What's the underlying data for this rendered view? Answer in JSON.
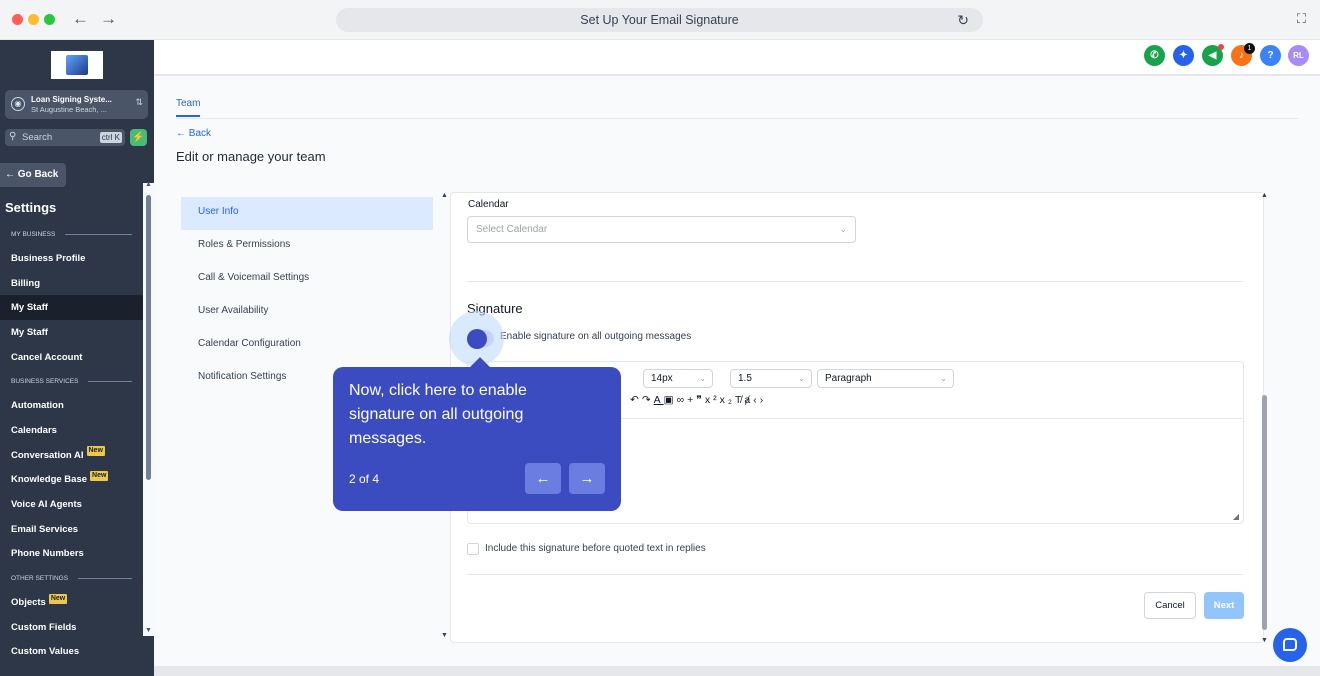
{
  "browser": {
    "url_title": "Set Up Your Email Signature"
  },
  "sidebar": {
    "account_name": "Loan Signing Syste...",
    "account_location": "St Augustine Beach, ...",
    "search_placeholder": "Search",
    "search_shortcut": "ctrl K",
    "go_back": "← Go Back",
    "settings_title": "Settings",
    "menu": [
      {
        "type": "section",
        "label": "MY BUSINESS"
      },
      {
        "type": "item",
        "label": "Business Profile"
      },
      {
        "type": "item",
        "label": "Billing"
      },
      {
        "type": "item",
        "label": "My Staff",
        "active": true
      },
      {
        "type": "item",
        "label": "My Staff"
      },
      {
        "type": "item",
        "label": "Cancel Account"
      },
      {
        "type": "section",
        "label": "BUSINESS SERVICES"
      },
      {
        "type": "item",
        "label": "Automation"
      },
      {
        "type": "item",
        "label": "Calendars"
      },
      {
        "type": "item",
        "label": "Conversation AI",
        "badge": "New"
      },
      {
        "type": "item",
        "label": "Knowledge Base",
        "badge": "New"
      },
      {
        "type": "item",
        "label": "Voice AI Agents"
      },
      {
        "type": "item",
        "label": "Email Services"
      },
      {
        "type": "item",
        "label": "Phone Numbers"
      },
      {
        "type": "section",
        "label": "OTHER SETTINGS"
      },
      {
        "type": "item",
        "label": "Objects",
        "badge": "New"
      },
      {
        "type": "item",
        "label": "Custom Fields"
      },
      {
        "type": "item",
        "label": "Custom Values"
      }
    ]
  },
  "topbar": {
    "notification_count": "1",
    "help": "?",
    "avatar": "RL"
  },
  "page": {
    "tab": "Team",
    "back": "Back",
    "title": "Edit or manage your team",
    "left_nav": [
      "User Info",
      "Roles & Permissions",
      "Call & Voicemail Settings",
      "User Availability",
      "Calendar Configuration",
      "Notification Settings"
    ]
  },
  "form": {
    "calendar_label": "Calendar",
    "calendar_placeholder": "Select Calendar",
    "signature_title": "Signature",
    "toggle_label": "Enable signature on all outgoing messages",
    "font_size": "14px",
    "line_height": "1.5",
    "paragraph": "Paragraph",
    "include_label": "Include this signature before quoted text in replies",
    "cancel": "Cancel",
    "next": "Next"
  },
  "tooltip": {
    "text": "Now, click here to enable signature on all outgoing messages.",
    "step": "2 of 4"
  },
  "colors": {
    "accent": "#2563eb",
    "tooltip": "#3b4cc0",
    "sidebar": "#2d3748"
  }
}
